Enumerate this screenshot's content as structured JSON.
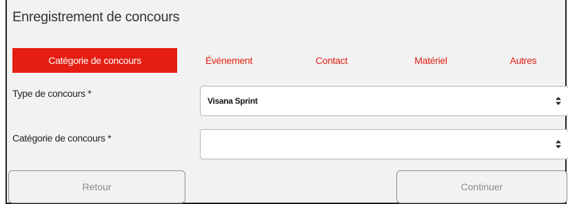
{
  "page": {
    "title": "Enregistrement de concours"
  },
  "tabs": [
    {
      "label": "Catégorie de concours",
      "active": true
    },
    {
      "label": "Événement",
      "active": false
    },
    {
      "label": "Contact",
      "active": false
    },
    {
      "label": "Matériel",
      "active": false
    },
    {
      "label": "Autres",
      "active": false
    }
  ],
  "form": {
    "type_label": "Type de concours *",
    "type_value": "Visana Sprint",
    "category_label": "Catégorie de concours *",
    "category_value": ""
  },
  "buttons": {
    "back": "Retour",
    "continue": "Continuer"
  },
  "colors": {
    "accent": "#e41e13",
    "background": "#f2f2f2"
  },
  "icons": {
    "select_arrows": "sort-arrows-icon"
  }
}
